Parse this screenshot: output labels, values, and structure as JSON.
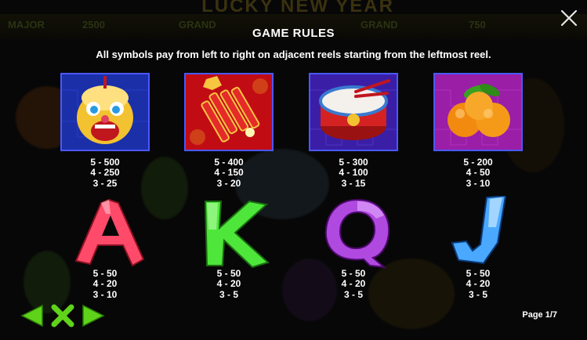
{
  "title": "GAME RULES",
  "subtitle": "All symbols pay from left to right on adjacent reels starting from the leftmost reel.",
  "page_indicator": "Page 1/7",
  "background": {
    "game_title": "LUCKY NEW YEAR",
    "tags": [
      "MAJOR",
      "2500",
      "GRAND",
      "GRAND",
      "750"
    ]
  },
  "symbols": [
    {
      "name": "Lion Dance",
      "pays": [
        "5 - 500",
        "4 - 250",
        "3 - 25"
      ]
    },
    {
      "name": "Firecrackers",
      "pays": [
        "5 - 400",
        "4 - 150",
        "3 - 20"
      ]
    },
    {
      "name": "Drum",
      "pays": [
        "5 - 300",
        "4 - 100",
        "3 - 15"
      ]
    },
    {
      "name": "Oranges",
      "pays": [
        "5 - 200",
        "4 - 50",
        "3 - 10"
      ]
    },
    {
      "name": "A",
      "pays": [
        "5 - 50",
        "4 - 20",
        "3 - 10"
      ]
    },
    {
      "name": "K",
      "pays": [
        "5 - 50",
        "4 - 20",
        "3 - 5"
      ]
    },
    {
      "name": "Q",
      "pays": [
        "5 - 50",
        "4 - 20",
        "3 - 5"
      ]
    },
    {
      "name": "J",
      "pays": [
        "5 - 50",
        "4 - 20",
        "3 - 5"
      ]
    }
  ],
  "colors": {
    "nav_green": "#5fd31a",
    "tile_border": "#4a58ff",
    "letter_a": "#ff4a6a",
    "letter_k": "#4ee63a",
    "letter_q": "#b049e0",
    "letter_j": "#4aa8ff"
  },
  "icons": {
    "close": "close-icon",
    "prev": "arrow-left-icon",
    "exit": "x-icon",
    "next": "arrow-right-icon"
  }
}
